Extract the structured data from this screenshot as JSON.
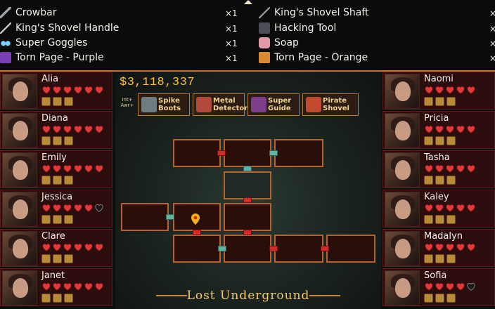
{
  "inventory": {
    "left_column": [
      {
        "label": "Crowbar",
        "qty": "×1",
        "icon": "crowbar-icon"
      },
      {
        "label": "King's Shovel Handle",
        "qty": "×1",
        "icon": "shovel-handle-icon"
      },
      {
        "label": "Super Goggles",
        "qty": "×1",
        "icon": "goggles-icon"
      },
      {
        "label": "Torn Page - Purple",
        "qty": "×1",
        "icon": "torn-page-purple-icon"
      }
    ],
    "right_column": [
      {
        "label": "King's Shovel Shaft",
        "qty": "×",
        "icon": "shovel-shaft-icon"
      },
      {
        "label": "Hacking Tool",
        "qty": "×",
        "icon": "hacking-tool-icon"
      },
      {
        "label": "Soap",
        "qty": "×",
        "icon": "soap-icon"
      },
      {
        "label": "Torn Page - Orange",
        "qty": "×",
        "icon": "torn-page-orange-icon"
      }
    ]
  },
  "hud": {
    "money": "$3,118,337",
    "stats_line1": "Int+",
    "stats_line2": "Awr+"
  },
  "tools": [
    {
      "label1": "Spike",
      "label2": "Boots",
      "icon": "spike-boots-icon"
    },
    {
      "label1": "Metal",
      "label2": "Detector",
      "icon": "metal-detector-icon"
    },
    {
      "label1": "Super",
      "label2": "Guide",
      "icon": "super-guide-icon"
    },
    {
      "label1": "Pirate",
      "label2": "Shovel",
      "icon": "pirate-shovel-icon"
    }
  ],
  "location_title": "Lost Underground",
  "characters_left": [
    {
      "name": "Alia",
      "hearts": [
        "full",
        "full",
        "full",
        "full",
        "full",
        "full"
      ]
    },
    {
      "name": "Diana",
      "hearts": [
        "full",
        "full",
        "full",
        "full",
        "full",
        "full"
      ]
    },
    {
      "name": "Emily",
      "hearts": [
        "full",
        "full",
        "full",
        "full",
        "full",
        "full"
      ]
    },
    {
      "name": "Jessica",
      "hearts": [
        "full",
        "full",
        "full",
        "full",
        "full",
        "empty"
      ]
    },
    {
      "name": "Clare",
      "hearts": [
        "full",
        "full",
        "full",
        "full",
        "full",
        "full"
      ]
    },
    {
      "name": "Janet",
      "hearts": [
        "full",
        "full",
        "full",
        "full",
        "full",
        "full"
      ]
    }
  ],
  "characters_right": [
    {
      "name": "Naomi",
      "hearts": [
        "full",
        "full",
        "full",
        "full",
        "full"
      ]
    },
    {
      "name": "Pricia",
      "hearts": [
        "full",
        "full",
        "full",
        "full",
        "full"
      ]
    },
    {
      "name": "Tasha",
      "hearts": [
        "full",
        "full",
        "full",
        "full",
        "full"
      ]
    },
    {
      "name": "Kaley",
      "hearts": [
        "full",
        "full",
        "full",
        "full",
        "full"
      ]
    },
    {
      "name": "Madalyn",
      "hearts": [
        "full",
        "full",
        "full",
        "full",
        "full"
      ]
    },
    {
      "name": "Sofia",
      "hearts": [
        "full",
        "full",
        "full",
        "full",
        "empty"
      ]
    }
  ],
  "colors": {
    "heart_full": "#e2393c",
    "heart_empty": "#1a1a1a",
    "accent_gold": "#ffbf2e",
    "room_border": "#b7622a",
    "door_red": "#d42a2a",
    "door_teal": "#64b2a6"
  }
}
